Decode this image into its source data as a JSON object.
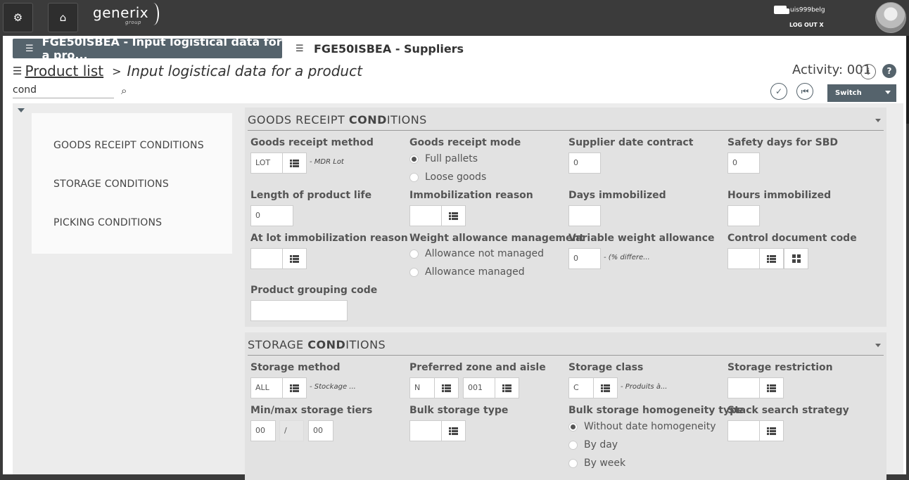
{
  "topbar": {
    "logo": "generix",
    "logo_sub": "group",
    "user": "uis999belg",
    "logout": "LOG OUT X"
  },
  "tabs": [
    {
      "label": "FGE50ISBEA - Input logistical data for a pro..."
    },
    {
      "label": "FGE50ISBEA - Suppliers"
    }
  ],
  "breadcrumb": {
    "link": "Product list",
    "sep": ">",
    "title": "Input logistical data for a product"
  },
  "search": {
    "value": "cond"
  },
  "activity": "Activity: 001",
  "switch_label": "Switch",
  "nav": [
    "GOODS RECEIPT CONDITIONS",
    "STORAGE CONDITIONS",
    "PICKING CONDITIONS"
  ],
  "goods_receipt": {
    "title_pre": "GOODS RECEIPT ",
    "title_bold": "COND",
    "title_post": "ITIONS",
    "method_label": "Goods receipt method",
    "method_value": "LOT",
    "method_desc": "- MDR Lot",
    "mode_label": "Goods receipt mode",
    "mode_options": [
      "Full pallets",
      "Loose goods"
    ],
    "supplier_date_label": "Supplier date contract",
    "supplier_date_value": "0",
    "safety_days_label": "Safety days for SBD",
    "safety_days_value": "0",
    "life_label": "Length of product life",
    "life_value": "0",
    "immob_reason_label": "Immobilization reason",
    "days_immob_label": "Days immobilized",
    "hours_immob_label": "Hours immobilized",
    "lot_immob_label": "At lot immobilization reason",
    "weight_mgmt_label": "Weight allowance management",
    "weight_mgmt_options": [
      "Allowance not managed",
      "Allowance managed"
    ],
    "var_weight_label": "Variable weight allowance",
    "var_weight_value": "0",
    "var_weight_desc": "- (% differe...",
    "control_doc_label": "Control document code",
    "grouping_label": "Product grouping code"
  },
  "storage": {
    "title_pre": "STORAGE ",
    "title_bold": "COND",
    "title_post": "ITIONS",
    "method_label": "Storage method",
    "method_value": "ALL",
    "method_desc": "- Stockage ...",
    "zone_label": "Preferred zone and aisle",
    "zone_value": "N",
    "aisle_value": "001",
    "class_label": "Storage class",
    "class_value": "C",
    "class_desc": "- Produits à...",
    "restriction_label": "Storage restriction",
    "tiers_label": "Min/max storage tiers",
    "tiers_min": "00",
    "tiers_sep": "/",
    "tiers_max": "00",
    "bulk_type_label": "Bulk storage type",
    "homog_label": "Bulk storage homogeneity type",
    "homog_options": [
      "Without date homogeneity",
      "By day",
      "By week"
    ],
    "stack_label": "Stack search strategy"
  }
}
